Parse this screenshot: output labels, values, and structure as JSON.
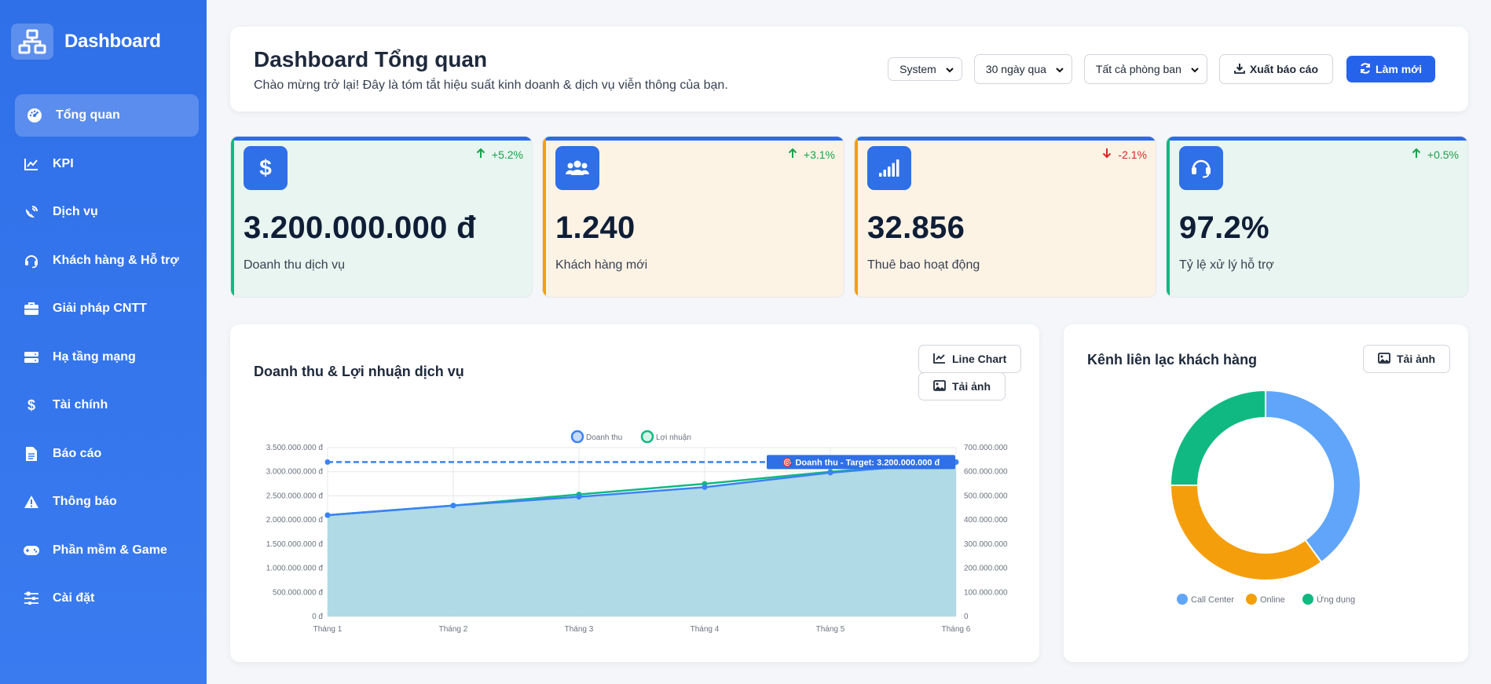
{
  "sidebar": {
    "brand": "Dashboard",
    "items": [
      {
        "label": "Tổng quan",
        "icon": "gauge-icon",
        "active": true
      },
      {
        "label": "KPI",
        "icon": "chart-line-icon"
      },
      {
        "label": "Dịch vụ",
        "icon": "satellite-dish-icon"
      },
      {
        "label": "Khách hàng & Hỗ trợ",
        "icon": "headset-icon"
      },
      {
        "label": "Giải pháp CNTT",
        "icon": "briefcase-icon"
      },
      {
        "label": "Hạ tầng mạng",
        "icon": "server-icon"
      },
      {
        "label": "Tài chính",
        "icon": "dollar-icon"
      },
      {
        "label": "Báo cáo",
        "icon": "file-icon"
      },
      {
        "label": "Thông báo",
        "icon": "warning-icon"
      },
      {
        "label": "Phần mềm & Game",
        "icon": "gamepad-icon"
      },
      {
        "label": "Cài đặt",
        "icon": "sliders-icon"
      }
    ]
  },
  "header": {
    "title": "Dashboard Tổng quan",
    "subtitle": "Chào mừng trở lại! Đây là tóm tắt hiệu suất kinh doanh & dịch vụ viễn thông của bạn.",
    "theme_select": "System",
    "period_select": "30 ngày qua",
    "department_select": "Tất cả phòng ban",
    "export_label": "Xuất báo cáo",
    "refresh_label": "Làm mới"
  },
  "kpis": [
    {
      "value": "3.200.000.000 đ",
      "label": "Doanh thu dịch vụ",
      "trend": "+5.2%",
      "direction": "up",
      "icon": "dollar-icon"
    },
    {
      "value": "1.240",
      "label": "Khách hàng mới",
      "trend": "+3.1%",
      "direction": "up",
      "icon": "users-icon"
    },
    {
      "value": "32.856",
      "label": "Thuê bao hoạt động",
      "trend": "-2.1%",
      "direction": "down",
      "icon": "signal-icon"
    },
    {
      "value": "97.2%",
      "label": "Tỷ lệ xử lý hỗ trợ",
      "trend": "+0.5%",
      "direction": "up",
      "icon": "headset-icon"
    }
  ],
  "revenue_card": {
    "title": "Doanh thu & Lợi nhuận dịch vụ",
    "chart_type_button": "Line Chart",
    "download_button": "Tải ảnh"
  },
  "channel_card": {
    "title": "Kênh liên lạc khách hàng",
    "download_button": "Tải ảnh"
  },
  "colors": {
    "primary": "#2563eb",
    "revenue_line": "#3b82f6",
    "profit_line": "#10b981",
    "area_fill": "#add8e6",
    "call_center": "#60a5fa",
    "online": "#f59e0b",
    "app": "#10b981"
  },
  "chart_data": [
    {
      "type": "line",
      "categories": [
        "Tháng 1",
        "Tháng 2",
        "Tháng 3",
        "Tháng 4",
        "Tháng 5",
        "Tháng 6"
      ],
      "series": [
        {
          "name": "Doanh thu",
          "axis": "left",
          "values": [
            2100000000,
            2300000000,
            2480000000,
            2680000000,
            2980000000,
            3200000000
          ]
        },
        {
          "name": "Lợi nhuận",
          "axis": "right",
          "values": [
            420000000,
            460000000,
            506000000,
            550000000,
            600000000,
            640000000
          ]
        }
      ],
      "y_left": {
        "min": 0,
        "max": 3500000000,
        "ticks": [
          "0 đ",
          "500.000.000 đ",
          "1.000.000.000 đ",
          "1.500.000.000 đ",
          "2.000.000.000 đ",
          "2.500.000.000 đ",
          "3.000.000.000 đ",
          "3.500.000.000 đ"
        ]
      },
      "y_right": {
        "min": 0,
        "max": 700000000,
        "ticks": [
          "0",
          "100.000.000",
          "200.000.000",
          "300.000.000",
          "400.000.000",
          "500.000.000",
          "600.000.000",
          "700.000.000"
        ]
      },
      "target": {
        "value": 3200000000,
        "label": "🎯 Doanh thu - Target: 3.200.000.000 đ"
      },
      "legend": "top",
      "grid": true
    },
    {
      "type": "pie",
      "donut": true,
      "labels": [
        "Call Center",
        "Online",
        "Ứng dụng"
      ],
      "values": [
        40,
        35,
        25
      ],
      "legend": "bottom"
    }
  ]
}
